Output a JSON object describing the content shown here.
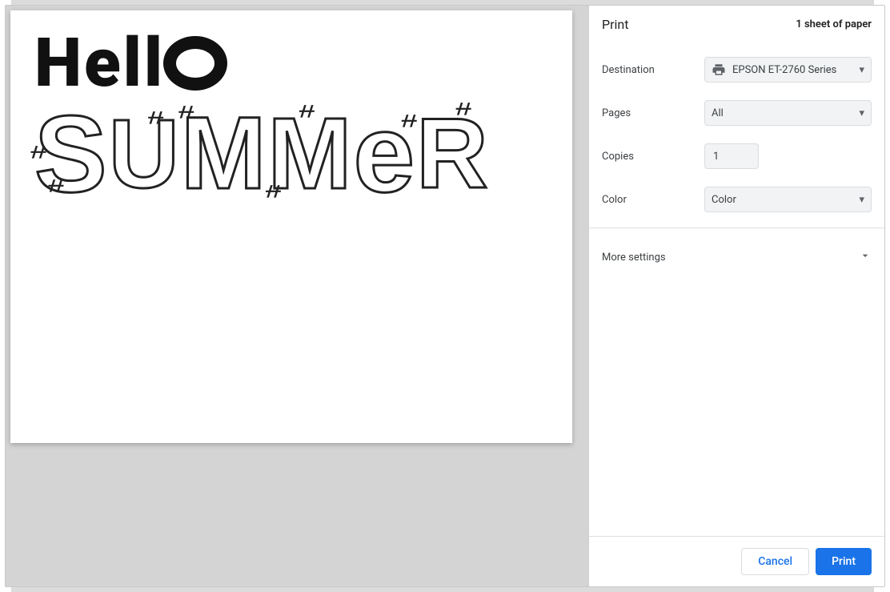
{
  "header": {
    "title": "Print",
    "sheet_count": "1 sheet of paper"
  },
  "rows": {
    "destination": {
      "label": "Destination",
      "value": "EPSON ET-2760 Series"
    },
    "pages": {
      "label": "Pages",
      "value": "All"
    },
    "copies": {
      "label": "Copies",
      "value": "1"
    },
    "color": {
      "label": "Color",
      "value": "Color"
    }
  },
  "more_settings": "More settings",
  "buttons": {
    "cancel": "Cancel",
    "print": "Print"
  },
  "preview": {
    "line1": "Hell",
    "summer_letters": [
      "S",
      "U",
      "M",
      "M",
      "e",
      "R"
    ]
  }
}
